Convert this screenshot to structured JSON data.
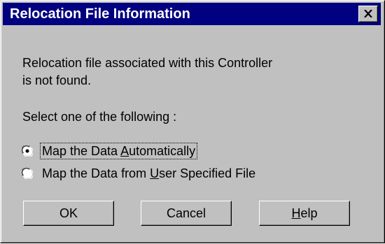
{
  "window": {
    "title": "Relocation File Information",
    "close_icon": "close-x-icon"
  },
  "message": {
    "line1": "Relocation file associated with this Controller",
    "line2": "is not found."
  },
  "prompt": "Select one of the following :",
  "options": [
    {
      "pre": "Map the Data ",
      "mnemonic": "A",
      "post": "utomatically",
      "checked": true
    },
    {
      "pre": "Map the Data from ",
      "mnemonic": "U",
      "post": "ser Specified File",
      "checked": false
    }
  ],
  "buttons": {
    "ok": {
      "label": "OK"
    },
    "cancel": {
      "label": "Cancel"
    },
    "help": {
      "mnemonic": "H",
      "rest": "elp"
    }
  },
  "colors": {
    "titlebar": "#000080",
    "face": "#c0c0c0"
  }
}
